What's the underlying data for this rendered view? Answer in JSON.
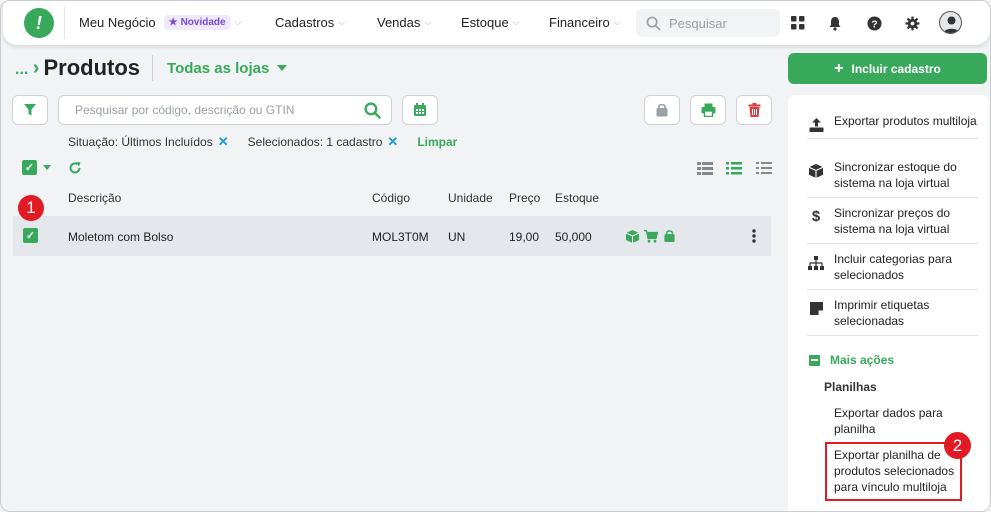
{
  "nav": {
    "logo": "!",
    "items": [
      {
        "label": "Meu Negócio",
        "badge": "Novidade"
      },
      {
        "label": "Cadastros"
      },
      {
        "label": "Vendas"
      },
      {
        "label": "Estoque"
      },
      {
        "label": "Financeiro"
      }
    ],
    "search_placeholder": "Pesquisar"
  },
  "page": {
    "breadcrumb": "...",
    "title": "Produtos",
    "store_select": "Todas as lojas"
  },
  "toolbar": {
    "search_placeholder": "Pesquisar por código, descrição ou GTIN"
  },
  "filters": {
    "situacao": "Situação: Últimos Incluídos",
    "selecionados": "Selecionados: 1 cadastro",
    "clear": "Limpar"
  },
  "table": {
    "headers": {
      "descricao": "Descrição",
      "codigo": "Código",
      "unidade": "Unidade",
      "preco": "Preço",
      "estoque": "Estoque"
    },
    "rows": [
      {
        "descricao": "Moletom com Bolso",
        "codigo": "MOL3T0M",
        "unidade": "UN",
        "preco": "19,00",
        "estoque": "50,000"
      }
    ]
  },
  "side": {
    "include_button": "Incluir cadastro",
    "actions": [
      {
        "label": "Exportar produtos multiloja",
        "icon": "export-icon"
      },
      {
        "label": "Sincronizar estoque do sistema na loja virtual",
        "icon": "box-icon"
      },
      {
        "label": "Sincronizar preços do sistema na loja virtual",
        "icon": "dollar-icon"
      },
      {
        "label": "Incluir categorias para selecionados",
        "icon": "sitemap-icon"
      },
      {
        "label": "Imprimir etiquetas selecionadas",
        "icon": "label-icon"
      }
    ],
    "more_actions": "Mais ações",
    "section": "Planilhas",
    "spreadsheet_items": [
      "Exportar dados para planilha",
      "Exportar planilha de produtos selecionados para vínculo multiloja"
    ]
  },
  "annotations": {
    "marker1": "1",
    "marker2": "2"
  },
  "colors": {
    "accent": "#38a95b",
    "marker": "#e21a23",
    "delete": "#e03b3b",
    "link": "#1e9ad6"
  }
}
